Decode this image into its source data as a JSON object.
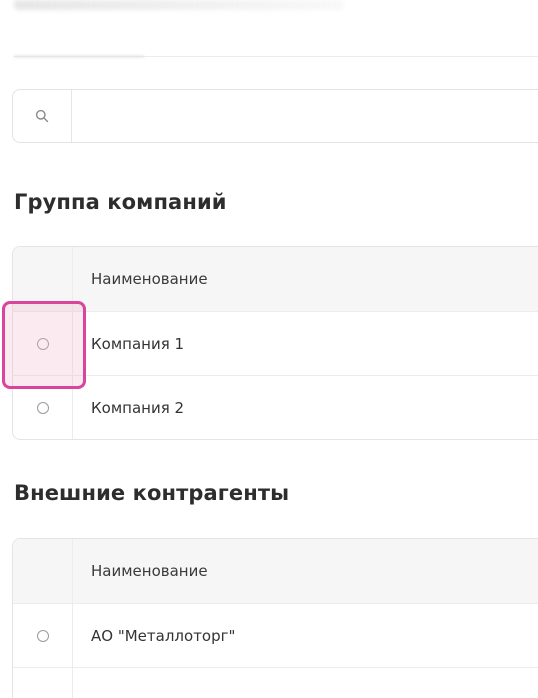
{
  "search": {
    "value": "",
    "placeholder": ""
  },
  "companies_group": {
    "title": "Группа компаний",
    "column_header": "Наименование",
    "rows": [
      {
        "name": "Компания 1",
        "selected": false
      },
      {
        "name": "Компания 2",
        "selected": false
      }
    ]
  },
  "external_contractors": {
    "title": "Внешние контрагенты",
    "column_header": "Наименование",
    "rows": [
      {
        "name": "АО \"Металлоторг\"",
        "selected": false
      }
    ]
  },
  "colors": {
    "highlight": "#d9459a",
    "header_bg": "#f6f6f6",
    "border": "#e4e4e4"
  },
  "icons": {
    "search": "search-icon",
    "radio": "radio-button"
  }
}
